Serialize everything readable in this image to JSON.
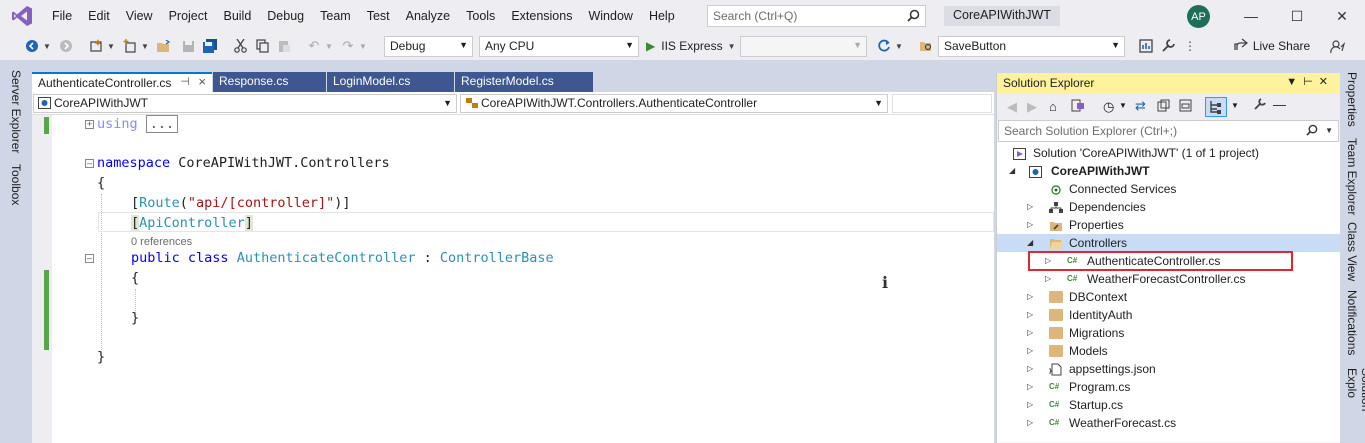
{
  "menu": [
    "File",
    "Edit",
    "View",
    "Project",
    "Build",
    "Debug",
    "Team",
    "Test",
    "Analyze",
    "Tools",
    "Extensions",
    "Window",
    "Help"
  ],
  "search": {
    "placeholder": "Search (Ctrl+Q)"
  },
  "solution_title": "CoreAPIWithJWT",
  "avatar_initials": "AP",
  "toolbar": {
    "config": "Debug",
    "platform": "Any CPU",
    "run_label": "IIS Express",
    "find_value": "SaveButton",
    "live_share": "Live Share"
  },
  "left_strip": [
    "Server Explorer",
    "Toolbox"
  ],
  "right_strip": [
    "Properties",
    "Team Explorer",
    "Class View",
    "Notifications",
    "Solution Explo"
  ],
  "editor": {
    "tabs": [
      "AuthenticateController.cs",
      "Response.cs",
      "LoginModel.cs",
      "RegisterModel.cs"
    ],
    "pin_glyph": "⊣",
    "close_glyph": "×",
    "nav_project": "CoreAPIWithJWT",
    "nav_type": "CoreAPIWithJWT.Controllers.AuthenticateController",
    "code": {
      "using_kw": "using",
      "using_ellipsis": "...",
      "namespace_kw": "namespace",
      "namespace_name": " CoreAPIWithJWT.Controllers",
      "open_brace": "{",
      "close_brace": "}",
      "route_open": "[",
      "route_attr": "Route",
      "route_paren": "(",
      "route_string": "\"api/[controller]\"",
      "route_close": ")]",
      "api_open": "[",
      "api_attr": "ApiController",
      "api_close": "]",
      "references": "0 references",
      "public_kw": "public",
      "class_kw": " class ",
      "class_name": "AuthenticateController",
      "colon": " : ",
      "base_name": "ControllerBase"
    }
  },
  "solution_explorer": {
    "title": "Solution Explorer",
    "search_placeholder": "Search Solution Explorer (Ctrl+;)",
    "solution_label": "Solution 'CoreAPIWithJWT' (1 of 1 project)",
    "project": "CoreAPIWithJWT",
    "items": [
      {
        "label": "Connected Services",
        "icon": "connected-services-icon"
      },
      {
        "label": "Dependencies",
        "icon": "dependencies-icon"
      },
      {
        "label": "Properties",
        "icon": "wrench-icon"
      },
      {
        "label": "Controllers",
        "icon": "folder-icon"
      },
      {
        "label": "AuthenticateController.cs",
        "icon": "csharp-file-icon"
      },
      {
        "label": "WeatherForecastController.cs",
        "icon": "csharp-file-icon"
      },
      {
        "label": "DBContext",
        "icon": "folder-icon"
      },
      {
        "label": "IdentityAuth",
        "icon": "folder-icon"
      },
      {
        "label": "Migrations",
        "icon": "folder-icon"
      },
      {
        "label": "Models",
        "icon": "folder-icon"
      },
      {
        "label": "appsettings.json",
        "icon": "json-file-icon"
      },
      {
        "label": "Program.cs",
        "icon": "csharp-file-icon"
      },
      {
        "label": "Startup.cs",
        "icon": "csharp-file-icon"
      },
      {
        "label": "WeatherForecast.cs",
        "icon": "csharp-file-icon"
      }
    ]
  },
  "colors": {
    "accent": "#007acc",
    "tab_inactive": "#3e5790",
    "keyword": "#0000ff",
    "type": "#2b91af",
    "string": "#a31515",
    "highlight": "#e0262e"
  }
}
